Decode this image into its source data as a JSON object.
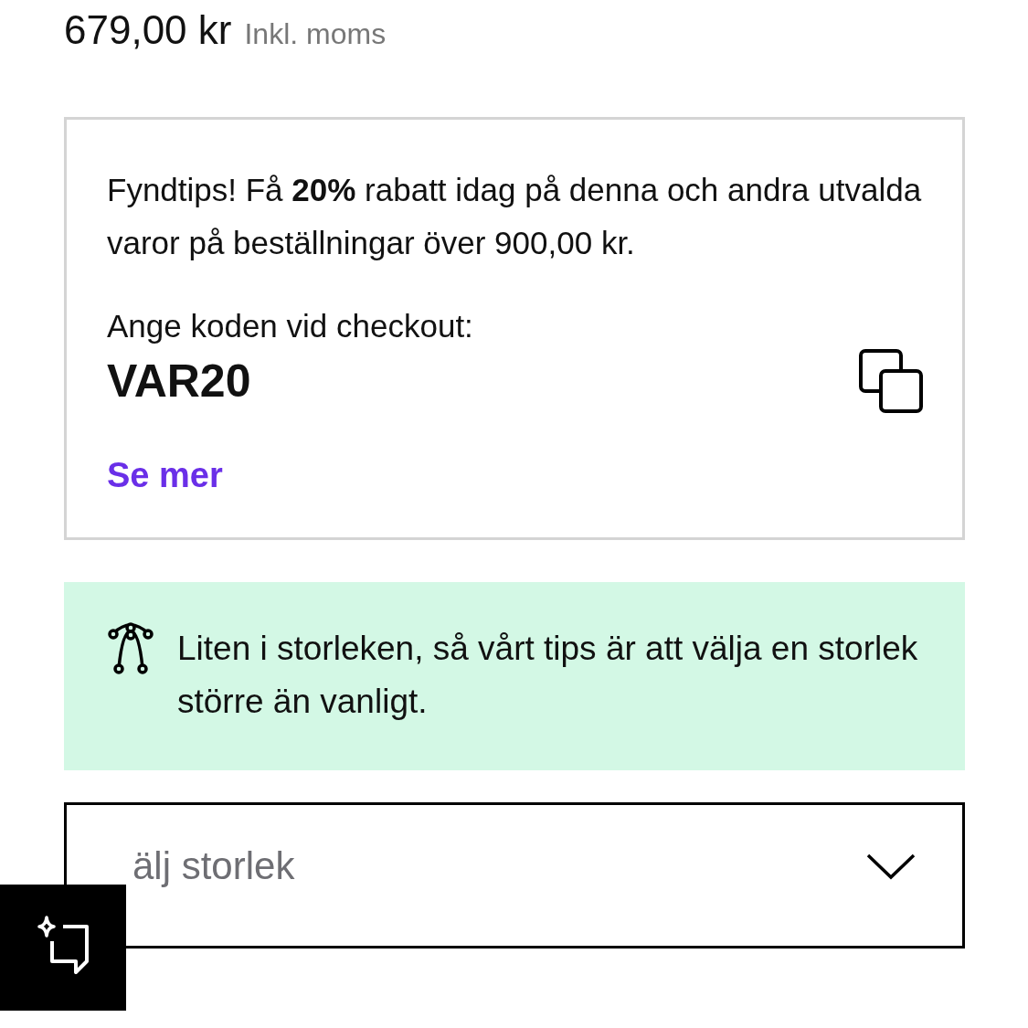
{
  "price": {
    "amount": "679,00 kr",
    "note": "Inkl. moms"
  },
  "promo": {
    "text": "Fyndtips! Få **20%** rabatt idag på denna och andra utvalda varor på beställningar över 900,00 kr.",
    "code_label": "Ange koden vid checkout:",
    "code": "VAR20",
    "link": "Se mer"
  },
  "fit_tip": {
    "text": "Liten i storleken, så vårt tips är att välja en storlek större än vanligt."
  },
  "size_select": {
    "placeholder": "älj storlek"
  }
}
